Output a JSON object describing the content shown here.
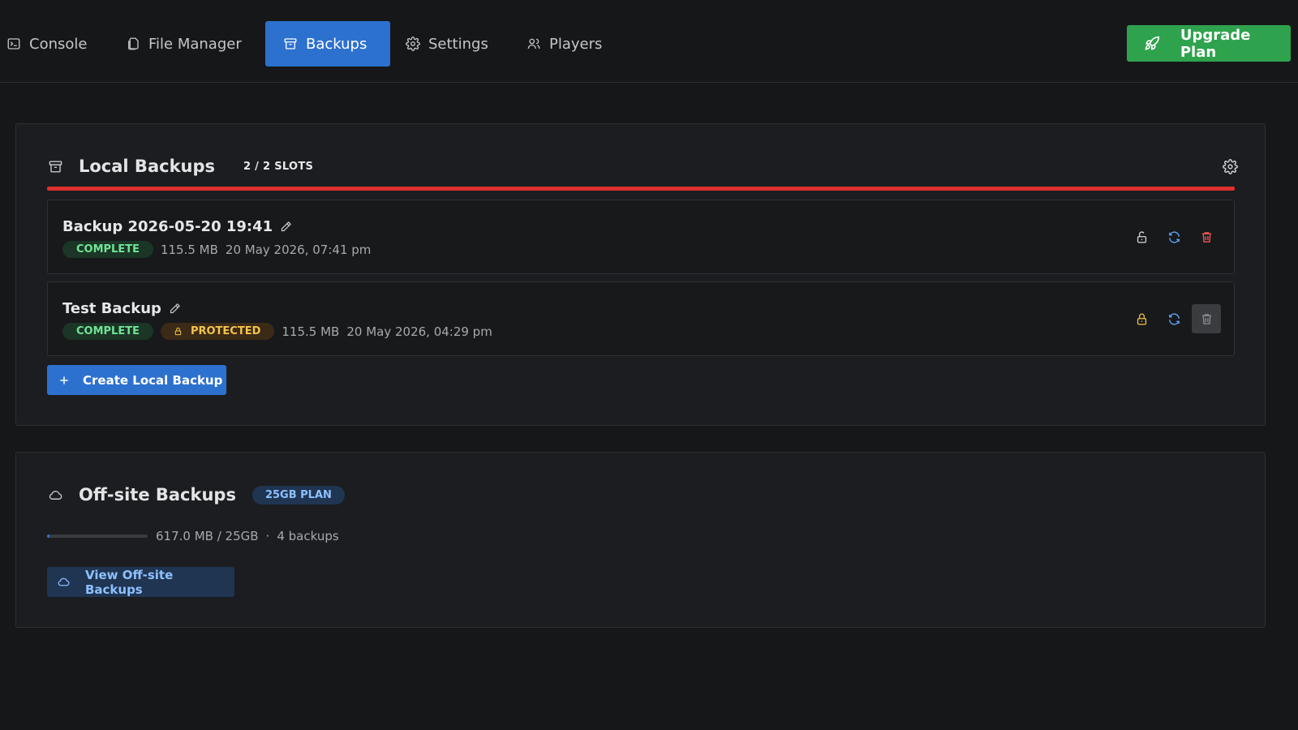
{
  "nav": {
    "tabs": [
      {
        "label": "Console",
        "icon": "terminal-icon"
      },
      {
        "label": "File Manager",
        "icon": "files-icon"
      },
      {
        "label": "Backups",
        "icon": "archive-icon",
        "active": true
      },
      {
        "label": "Settings",
        "icon": "gear-icon"
      },
      {
        "label": "Players",
        "icon": "users-icon"
      }
    ],
    "upgrade_label": "Upgrade Plan",
    "upgrade_icon": "rocket-icon"
  },
  "local": {
    "title": "Local Backups",
    "slots": "2 / 2 SLOTS",
    "slot_usage_fraction": 1.0,
    "backups": [
      {
        "name": "Backup 2026-05-20 19:41",
        "status": "COMPLETE",
        "protected": false,
        "size": "115.5 MB",
        "date": "20 May 2026, 07:41 pm"
      },
      {
        "name": "Test Backup",
        "status": "COMPLETE",
        "protected": true,
        "protected_label": "PROTECTED",
        "size": "115.5 MB",
        "date": "20 May 2026, 04:29 pm"
      }
    ],
    "create_label": "Create Local Backup"
  },
  "offsite": {
    "title": "Off-site Backups",
    "plan": "25GB PLAN",
    "usage": "617.0 MB / 25GB",
    "usage_fraction": 0.024,
    "separator": "·",
    "count": "4 backups",
    "view_label": "View Off-site Backups"
  },
  "colors": {
    "accent": "#2d71cf",
    "upgrade": "#2fa24d",
    "slots_full": "#e0302f",
    "complete": "#6fe596",
    "protected": "#f2c44b",
    "delete": "#ff5a5a"
  }
}
